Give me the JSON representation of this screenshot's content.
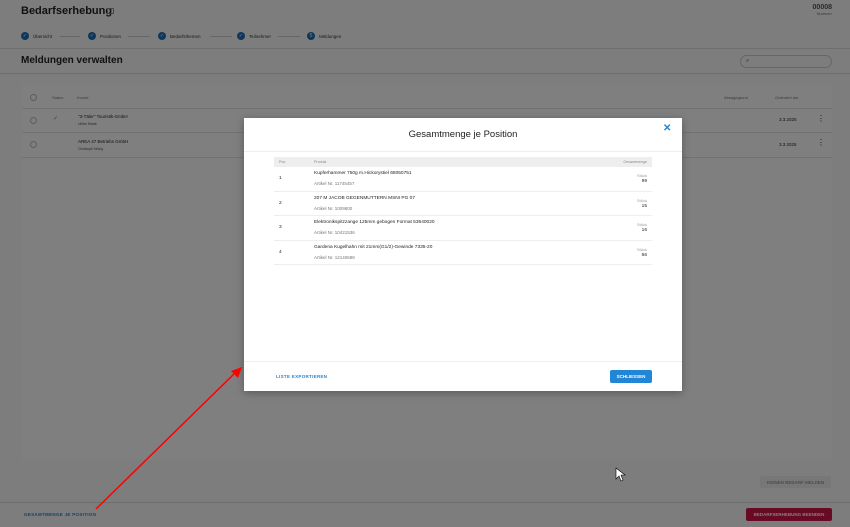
{
  "header": {
    "title": "Bedarfserhebung",
    "number": "00008",
    "number_label": "Nummer"
  },
  "steps": [
    {
      "label": "Übersicht",
      "done": true
    },
    {
      "label": "Positionen",
      "done": true
    },
    {
      "label": "Bedarfsthemen",
      "done": true
    },
    {
      "label": "Teilnehmer",
      "done": true
    },
    {
      "label": "Meldungen",
      "done": false,
      "index": "5"
    }
  ],
  "section": {
    "title": "Meldungen verwalten",
    "search_placeholder": ""
  },
  "table": {
    "columns": {
      "status": "Status",
      "customer": "Kunde",
      "reason": "Absagegrund",
      "changed": "Geändert am"
    },
    "rows": [
      {
        "customer": "\"3-Täler\" Touristik-GmbH",
        "contact": "Ulrike Marte",
        "changed": "3.3.2025",
        "status": "ok"
      },
      {
        "customer": "AREA 47 Betriebs GmbH",
        "contact": "Christoph Nösig",
        "changed": "3.3.2025",
        "status": "none"
      }
    ]
  },
  "modal": {
    "title": "Gesamtmenge je Position",
    "columns": {
      "pos": "Pos.",
      "product": "Produkt",
      "total": "Gesamtmenge"
    },
    "rows": [
      {
        "pos": "1",
        "product": "Kupferhammer 750g m.Hickorystiel 68050751",
        "article": "Artikel Nr. 11745457",
        "unit": "Stück",
        "qty": "99"
      },
      {
        "pos": "2",
        "product": "207 M JACOB GEGENMUTTERN MSNI PG 07",
        "article": "Artikel Nr. 1009800",
        "unit": "Stück",
        "qty": "15"
      },
      {
        "pos": "3",
        "product": "Elektronikspitzzange 125mm gebogen Format 53540020",
        "article": "Artikel Nr. 10421536",
        "unit": "Stück",
        "qty": "16"
      },
      {
        "pos": "4",
        "product": "Gardena Kugelhahn mit 21mm(G1/2)-Gewinde 7335-20",
        "article": "Artikel Nr. 12140688",
        "unit": "Stück",
        "qty": "66"
      }
    ],
    "export_label": "LISTE EXPORTIEREN",
    "close_label": "SCHLIESSEN"
  },
  "footer": {
    "no_need_label": "KEINEN BEDARF MELDEN",
    "total_link": "GESAMTMENGE JE POSITION",
    "finish_label": "BEDARFSERHEBUNG BEENDEN"
  },
  "colors": {
    "accent": "#2186d6",
    "step": "#1f6fb5",
    "finish": "#b0103c",
    "annotation": "#ff0000"
  }
}
